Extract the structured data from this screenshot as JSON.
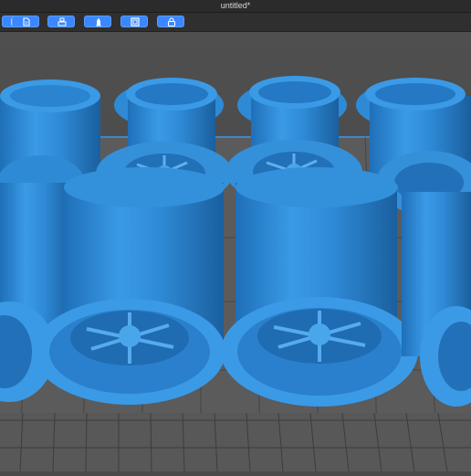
{
  "window": {
    "title": "untitled*"
  },
  "toolbar": {
    "buttons": [
      {
        "icon": "rectangle-icon"
      },
      {
        "icon": "document-icon"
      },
      {
        "icon": "printer-stack-icon"
      },
      {
        "icon": "rocket-icon"
      },
      {
        "icon": "square-frame-icon"
      },
      {
        "icon": "lock-icon"
      }
    ]
  },
  "colors": {
    "accent": "#3b87ff",
    "model": "#2f8ad6",
    "platform": "#5f5f5f",
    "background": "#4a4a4a"
  },
  "scene": {
    "object": "wheel-rim",
    "count_visible": 8
  }
}
